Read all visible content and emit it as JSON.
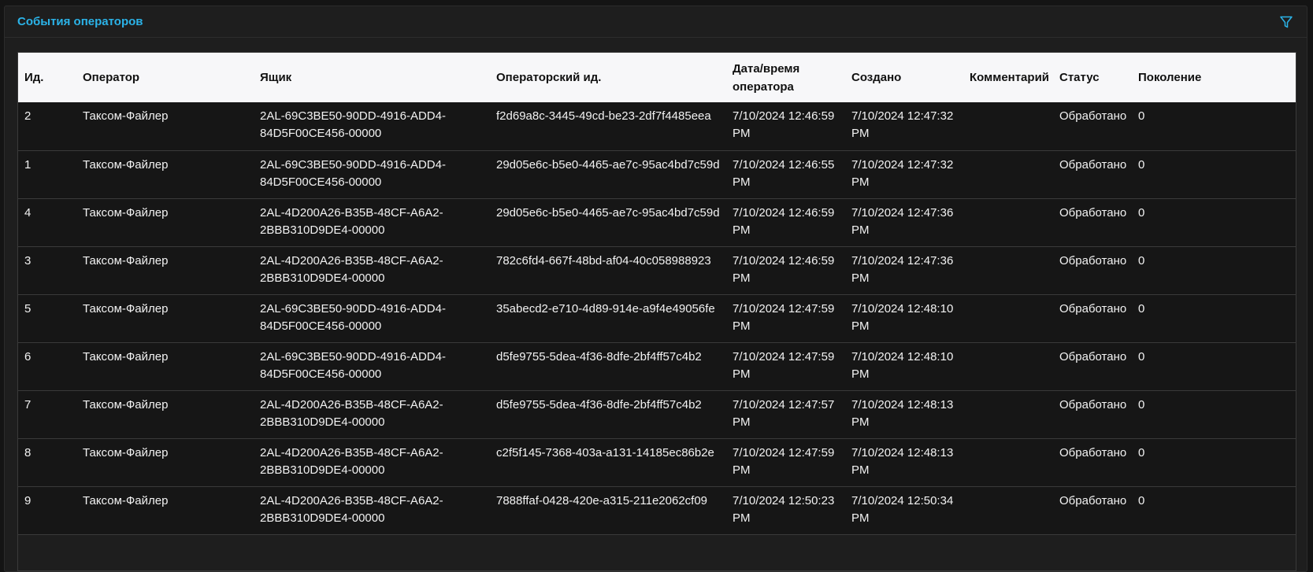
{
  "panel": {
    "title": "События операторов",
    "filter_icon": "filter-icon",
    "accent_color": "#2bb3e8"
  },
  "table": {
    "columns": [
      "Ид.",
      "Оператор",
      "Ящик",
      "Операторский ид.",
      "Дата/время оператора",
      "Создано",
      "Комментарий",
      "Статус",
      "Поколение"
    ],
    "rows": [
      {
        "id": "2",
        "operator": "Таксом-Файлер",
        "box": "2AL-69C3BE50-90DD-4916-ADD4-84D5F00CE456-00000",
        "operator_id": "f2d69a8c-3445-49cd-be23-2df7f4485eea",
        "operator_datetime": "7/10/2024 12:46:59 PM",
        "created": "7/10/2024 12:47:32 PM",
        "comment": "",
        "status": "Обработано",
        "generation": "0"
      },
      {
        "id": "1",
        "operator": "Таксом-Файлер",
        "box": "2AL-69C3BE50-90DD-4916-ADD4-84D5F00CE456-00000",
        "operator_id": "29d05e6c-b5e0-4465-ae7c-95ac4bd7c59d",
        "operator_datetime": "7/10/2024 12:46:55 PM",
        "created": "7/10/2024 12:47:32 PM",
        "comment": "",
        "status": "Обработано",
        "generation": "0"
      },
      {
        "id": "4",
        "operator": "Таксом-Файлер",
        "box": "2AL-4D200A26-B35B-48CF-A6A2-2BBB310D9DE4-00000",
        "operator_id": "29d05e6c-b5e0-4465-ae7c-95ac4bd7c59d",
        "operator_datetime": "7/10/2024 12:46:59 PM",
        "created": "7/10/2024 12:47:36 PM",
        "comment": "",
        "status": "Обработано",
        "generation": "0"
      },
      {
        "id": "3",
        "operator": "Таксом-Файлер",
        "box": "2AL-4D200A26-B35B-48CF-A6A2-2BBB310D9DE4-00000",
        "operator_id": "782c6fd4-667f-48bd-af04-40c058988923",
        "operator_datetime": "7/10/2024 12:46:59 PM",
        "created": "7/10/2024 12:47:36 PM",
        "comment": "",
        "status": "Обработано",
        "generation": "0"
      },
      {
        "id": "5",
        "operator": "Таксом-Файлер",
        "box": "2AL-69C3BE50-90DD-4916-ADD4-84D5F00CE456-00000",
        "operator_id": "35abecd2-e710-4d89-914e-a9f4e49056fe",
        "operator_datetime": "7/10/2024 12:47:59 PM",
        "created": "7/10/2024 12:48:10 PM",
        "comment": "",
        "status": "Обработано",
        "generation": "0"
      },
      {
        "id": "6",
        "operator": "Таксом-Файлер",
        "box": "2AL-69C3BE50-90DD-4916-ADD4-84D5F00CE456-00000",
        "operator_id": "d5fe9755-5dea-4f36-8dfe-2bf4ff57c4b2",
        "operator_datetime": "7/10/2024 12:47:59 PM",
        "created": "7/10/2024 12:48:10 PM",
        "comment": "",
        "status": "Обработано",
        "generation": "0"
      },
      {
        "id": "7",
        "operator": "Таксом-Файлер",
        "box": "2AL-4D200A26-B35B-48CF-A6A2-2BBB310D9DE4-00000",
        "operator_id": "d5fe9755-5dea-4f36-8dfe-2bf4ff57c4b2",
        "operator_datetime": "7/10/2024 12:47:57 PM",
        "created": "7/10/2024 12:48:13 PM",
        "comment": "",
        "status": "Обработано",
        "generation": "0"
      },
      {
        "id": "8",
        "operator": "Таксом-Файлер",
        "box": "2AL-4D200A26-B35B-48CF-A6A2-2BBB310D9DE4-00000",
        "operator_id": "c2f5f145-7368-403a-a131-14185ec86b2e",
        "operator_datetime": "7/10/2024 12:47:59 PM",
        "created": "7/10/2024 12:48:13 PM",
        "comment": "",
        "status": "Обработано",
        "generation": "0"
      },
      {
        "id": "9",
        "operator": "Таксом-Файлер",
        "box": "2AL-4D200A26-B35B-48CF-A6A2-2BBB310D9DE4-00000",
        "operator_id": "7888ffaf-0428-420e-a315-211e2062cf09",
        "operator_datetime": "7/10/2024 12:50:23 PM",
        "created": "7/10/2024 12:50:34 PM",
        "comment": "",
        "status": "Обработано",
        "generation": "0"
      }
    ]
  }
}
